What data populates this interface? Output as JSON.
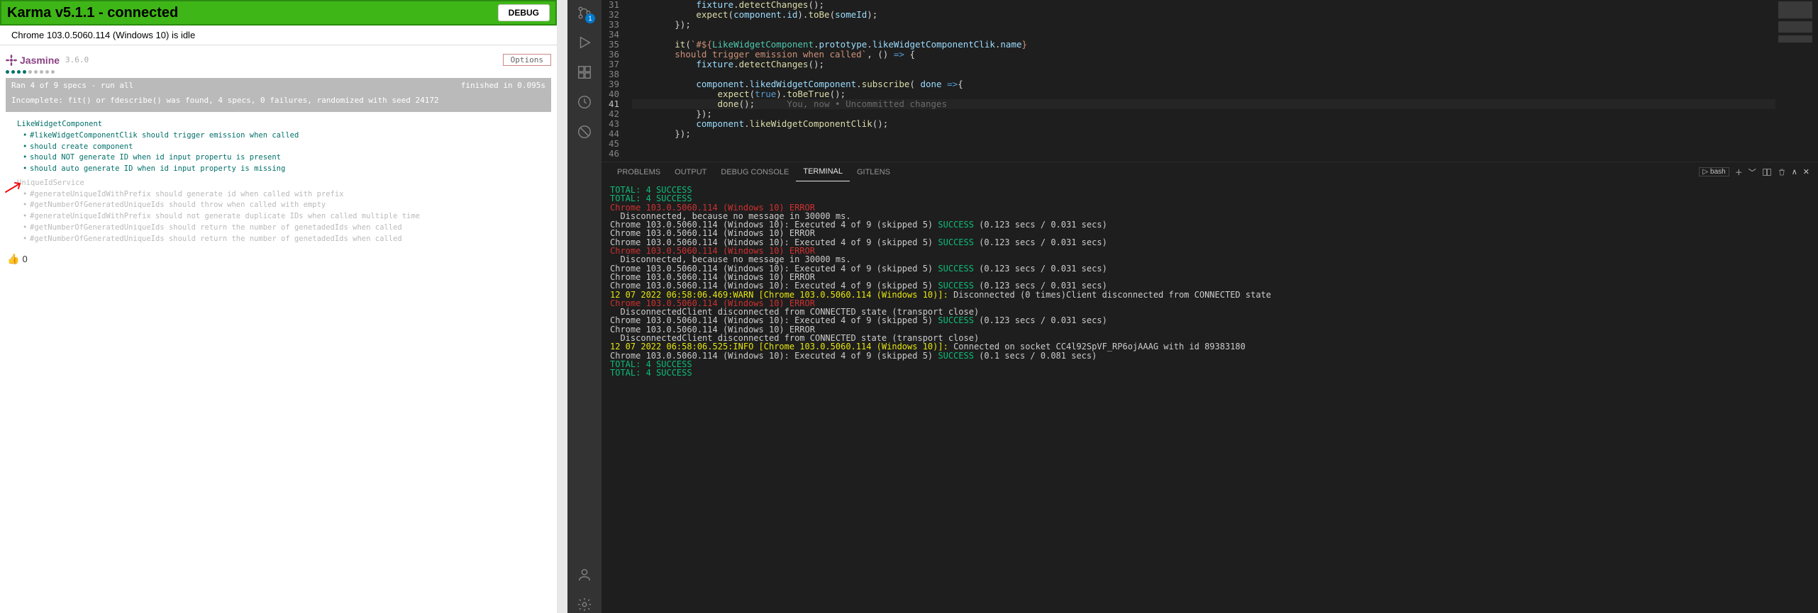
{
  "karma": {
    "title": "Karma v5.1.1 - connected",
    "debug_label": "DEBUG",
    "browser_status": "Chrome 103.0.5060.114 (Windows 10) is idle",
    "jasmine_label": "Jasmine",
    "jasmine_version": "3.6.0",
    "options_label": "Options",
    "dots": [
      "pass",
      "pass",
      "pass",
      "pass",
      "skip",
      "skip",
      "skip",
      "skip",
      "skip"
    ],
    "run_summary": "Ran 4 of 9 specs - run all",
    "finished_in": "finished in 0.095s",
    "incomplete": "Incomplete: fit() or fdescribe() was found, 4 specs, 0 failures, randomized with seed 24172",
    "suites": [
      {
        "name": "LikeWidgetComponent",
        "pending": false,
        "specs": [
          {
            "label": "#likeWidgetComponentClik should trigger emission when called",
            "pending": false
          },
          {
            "label": "should create component",
            "pending": false
          },
          {
            "label": "should NOT generate ID when id input propertu is present",
            "pending": false
          },
          {
            "label": "should auto generate ID when id input property is missing",
            "pending": false
          }
        ]
      },
      {
        "name": "UniqueIdService",
        "pending": true,
        "specs": [
          {
            "label": "#generateUniqueIdWithPrefix should generate id when called with prefix",
            "pending": true
          },
          {
            "label": "#getNumberOfGeneratedUniqueIds should throw when called with empty",
            "pending": true
          },
          {
            "label": "#generateUniqueIdWithPrefix should not generate duplicate IDs when called multiple time",
            "pending": true
          },
          {
            "label": "#getNumberOfGeneratedUniqueIds should return the number of genetadedIds when called",
            "pending": true
          },
          {
            "label": "#getNumberOfGeneratedUniqueIds should return the number of genetadedIds when called",
            "pending": true
          }
        ]
      }
    ],
    "like_count": "0"
  },
  "vscode": {
    "activity_badge": "1",
    "code_lines": [
      {
        "n": 31,
        "indent": 3,
        "tokens": [
          [
            "var",
            "fixture"
          ],
          [
            "punc",
            "."
          ],
          [
            "fn",
            "detectChanges"
          ],
          [
            "punc",
            "();"
          ]
        ]
      },
      {
        "n": 32,
        "indent": 3,
        "tokens": [
          [
            "fn",
            "expect"
          ],
          [
            "punc",
            "("
          ],
          [
            "var",
            "component"
          ],
          [
            "punc",
            "."
          ],
          [
            "prop",
            "id"
          ],
          [
            "punc",
            ")."
          ],
          [
            "fn",
            "toBe"
          ],
          [
            "punc",
            "("
          ],
          [
            "var",
            "someId"
          ],
          [
            "punc",
            ");"
          ]
        ]
      },
      {
        "n": 33,
        "indent": 2,
        "tokens": [
          [
            "punc",
            "});"
          ]
        ]
      },
      {
        "n": 34,
        "indent": 0,
        "tokens": []
      },
      {
        "n": 35,
        "indent": 2,
        "tokens": [
          [
            "fn",
            "it"
          ],
          [
            "punc",
            "("
          ],
          [
            "tpl",
            "`#${"
          ],
          [
            "type",
            "LikeWidgetComponent"
          ],
          [
            "punc",
            "."
          ],
          [
            "prop",
            "prototype"
          ],
          [
            "punc",
            "."
          ],
          [
            "prop",
            "likeWidgetComponentClik"
          ],
          [
            "punc",
            "."
          ],
          [
            "prop",
            "name"
          ],
          [
            "tpl",
            "}"
          ]
        ]
      },
      {
        "n": 36,
        "indent": 2,
        "tokens": [
          [
            "tpl",
            "should trigger emission when called`"
          ],
          [
            "punc",
            ", () "
          ],
          [
            "kw",
            "=>"
          ],
          [
            "punc",
            " {"
          ]
        ]
      },
      {
        "n": 37,
        "indent": 3,
        "tokens": [
          [
            "var",
            "fixture"
          ],
          [
            "punc",
            "."
          ],
          [
            "fn",
            "detectChanges"
          ],
          [
            "punc",
            "();"
          ]
        ]
      },
      {
        "n": 38,
        "indent": 0,
        "tokens": []
      },
      {
        "n": 39,
        "indent": 3,
        "tokens": [
          [
            "var",
            "component"
          ],
          [
            "punc",
            "."
          ],
          [
            "prop",
            "likedWidgetComponent"
          ],
          [
            "punc",
            "."
          ],
          [
            "fn",
            "subscribe"
          ],
          [
            "punc",
            "( "
          ],
          [
            "var",
            "done"
          ],
          [
            "punc",
            " "
          ],
          [
            "kw",
            "=>"
          ],
          [
            "punc",
            "{"
          ]
        ]
      },
      {
        "n": 40,
        "indent": 4,
        "tokens": [
          [
            "fn",
            "expect"
          ],
          [
            "punc",
            "("
          ],
          [
            "const",
            "true"
          ],
          [
            "punc",
            ")."
          ],
          [
            "fn",
            "toBeTrue"
          ],
          [
            "punc",
            "();"
          ]
        ]
      },
      {
        "n": 41,
        "indent": 4,
        "cur": true,
        "tokens": [
          [
            "fn",
            "done"
          ],
          [
            "punc",
            "();"
          ]
        ],
        "codelens": "      You, now • Uncommitted changes"
      },
      {
        "n": 42,
        "indent": 3,
        "tokens": [
          [
            "punc",
            "});"
          ]
        ]
      },
      {
        "n": 43,
        "indent": 3,
        "tokens": [
          [
            "var",
            "component"
          ],
          [
            "punc",
            "."
          ],
          [
            "fn",
            "likeWidgetComponentClik"
          ],
          [
            "punc",
            "();"
          ]
        ]
      },
      {
        "n": 44,
        "indent": 2,
        "tokens": [
          [
            "punc",
            "});"
          ]
        ]
      },
      {
        "n": 45,
        "indent": 0,
        "tokens": []
      },
      {
        "n": 46,
        "indent": 0,
        "tokens": []
      }
    ],
    "panel_tabs": {
      "problems": "PROBLEMS",
      "output": "OUTPUT",
      "debug_console": "DEBUG CONSOLE",
      "terminal": "TERMINAL",
      "gitlens": "GITLENS"
    },
    "shell_label": "bash",
    "terminal_lines": [
      {
        "cls": "t-green",
        "text": "TOTAL: 4 SUCCESS"
      },
      {
        "cls": "t-green",
        "text": "TOTAL: 4 SUCCESS"
      },
      {
        "cls": "t-red",
        "text": "Chrome 103.0.5060.114 (Windows 10) ERROR"
      },
      {
        "cls": "t-white",
        "text": "  Disconnected, because no message in 30000 ms."
      },
      {
        "cls": "t-white",
        "text": "Chrome 103.0.5060.114 (Windows 10): Executed 4 of 9 (skipped 5) ",
        "suffix_cls": "t-green",
        "suffix": "SUCCESS",
        "tail": " (0.123 secs / 0.031 secs)"
      },
      {
        "cls": "t-white",
        "text": "Chrome 103.0.5060.114 (Windows 10) ERROR"
      },
      {
        "cls": "t-white",
        "text": "Chrome 103.0.5060.114 (Windows 10): Executed 4 of 9 (skipped 5) ",
        "suffix_cls": "t-green",
        "suffix": "SUCCESS",
        "tail": " (0.123 secs / 0.031 secs)"
      },
      {
        "cls": "t-red",
        "text": "Chrome 103.0.5060.114 (Windows 10) ERROR"
      },
      {
        "cls": "t-white",
        "text": "  Disconnected, because no message in 30000 ms."
      },
      {
        "cls": "t-white",
        "text": "Chrome 103.0.5060.114 (Windows 10): Executed 4 of 9 (skipped 5) ",
        "suffix_cls": "t-green",
        "suffix": "SUCCESS",
        "tail": " (0.123 secs / 0.031 secs)"
      },
      {
        "cls": "t-white",
        "text": "Chrome 103.0.5060.114 (Windows 10) ERROR"
      },
      {
        "cls": "t-white",
        "text": "Chrome 103.0.5060.114 (Windows 10): Executed 4 of 9 (skipped 5) ",
        "suffix_cls": "t-green",
        "suffix": "SUCCESS",
        "tail": " (0.123 secs / 0.031 secs)"
      },
      {
        "cls": "t-yellow",
        "text": "12 07 2022 06:58:06.469:WARN [Chrome 103.0.5060.114 (Windows 10)]: ",
        "tail_cls": "t-white",
        "tail": "Disconnected (0 times)Client disconnected from CONNECTED state"
      },
      {
        "cls": "t-red",
        "text": "Chrome 103.0.5060.114 (Windows 10) ERROR"
      },
      {
        "cls": "t-white",
        "text": "  DisconnectedClient disconnected from CONNECTED state (transport close)"
      },
      {
        "cls": "t-white",
        "text": "Chrome 103.0.5060.114 (Windows 10): Executed 4 of 9 (skipped 5) ",
        "suffix_cls": "t-green",
        "suffix": "SUCCESS",
        "tail": " (0.123 secs / 0.031 secs)"
      },
      {
        "cls": "t-white",
        "text": "Chrome 103.0.5060.114 (Windows 10) ERROR"
      },
      {
        "cls": "t-white",
        "text": "  DisconnectedClient disconnected from CONNECTED state (transport close)"
      },
      {
        "cls": "t-yellow",
        "text": "12 07 2022 06:58:06.525:INFO [Chrome 103.0.5060.114 (Windows 10)]: ",
        "tail_cls": "t-white",
        "tail": "Connected on socket CC4l92SpVF_RP6ojAAAG with id 89383180"
      },
      {
        "cls": "t-white",
        "text": "Chrome 103.0.5060.114 (Windows 10): Executed 4 of 9 (skipped 5) ",
        "suffix_cls": "t-green",
        "suffix": "SUCCESS",
        "tail": " (0.1 secs / 0.081 secs)"
      },
      {
        "cls": "t-green",
        "text": "TOTAL: 4 SUCCESS"
      },
      {
        "cls": "t-green",
        "text": "TOTAL: 4 SUCCESS"
      }
    ]
  }
}
